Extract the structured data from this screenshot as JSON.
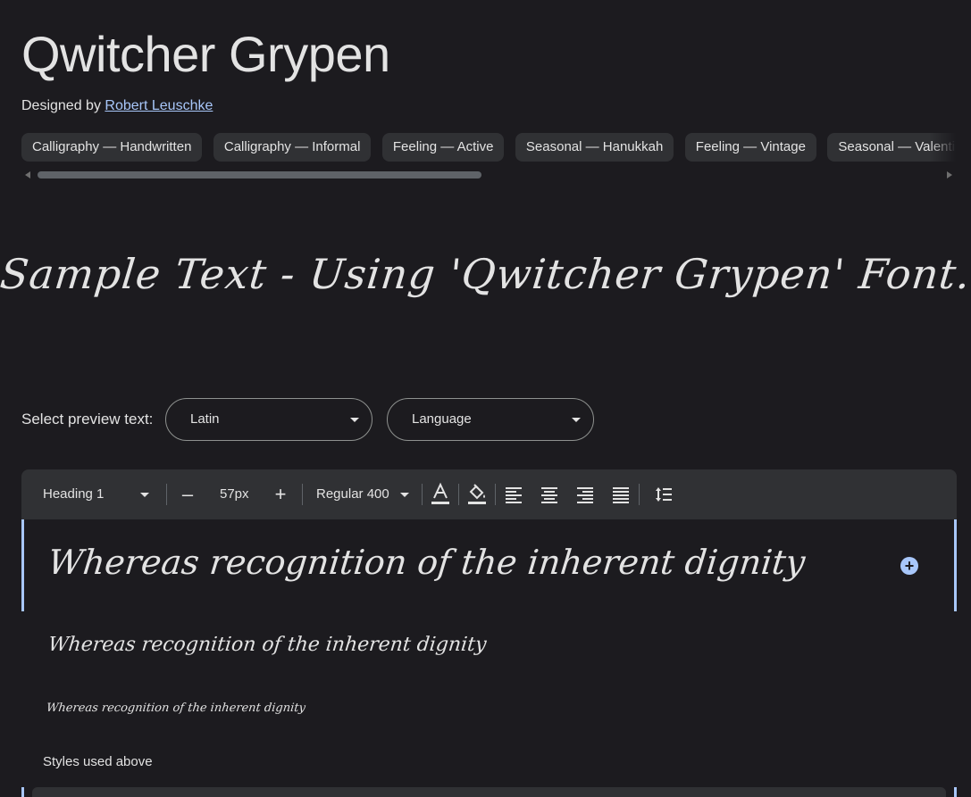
{
  "font_title": "Qwitcher Grypen",
  "designer": {
    "prefix": "Designed by",
    "name": "Robert Leuschke"
  },
  "tags": [
    "Calligraphy — Handwritten",
    "Calligraphy — Informal",
    "Feeling — Active",
    "Seasonal — Hanukkah",
    "Feeling — Vintage",
    "Seasonal — Valentine's"
  ],
  "hero_sample": "Sample Text - Using 'Qwitcher Grypen' Font.",
  "preview_controls": {
    "label": "Select preview text:",
    "script_select": "Latin",
    "language_select": "Language"
  },
  "toolbar": {
    "style_select": "Heading 1",
    "decrease": "–",
    "size": "57px",
    "increase": "+",
    "weight_select": "Regular 400"
  },
  "preview_rows": [
    "Whereas recognition of the inherent dignity",
    "Whereas recognition of the inherent dignity",
    "Whereas recognition of the inherent dignity"
  ],
  "styles_used_label": "Styles used above",
  "colors": {
    "background": "#1c1b1f",
    "surface": "#303134",
    "accent": "#a8c7fa",
    "text": "#e3e3e3"
  }
}
